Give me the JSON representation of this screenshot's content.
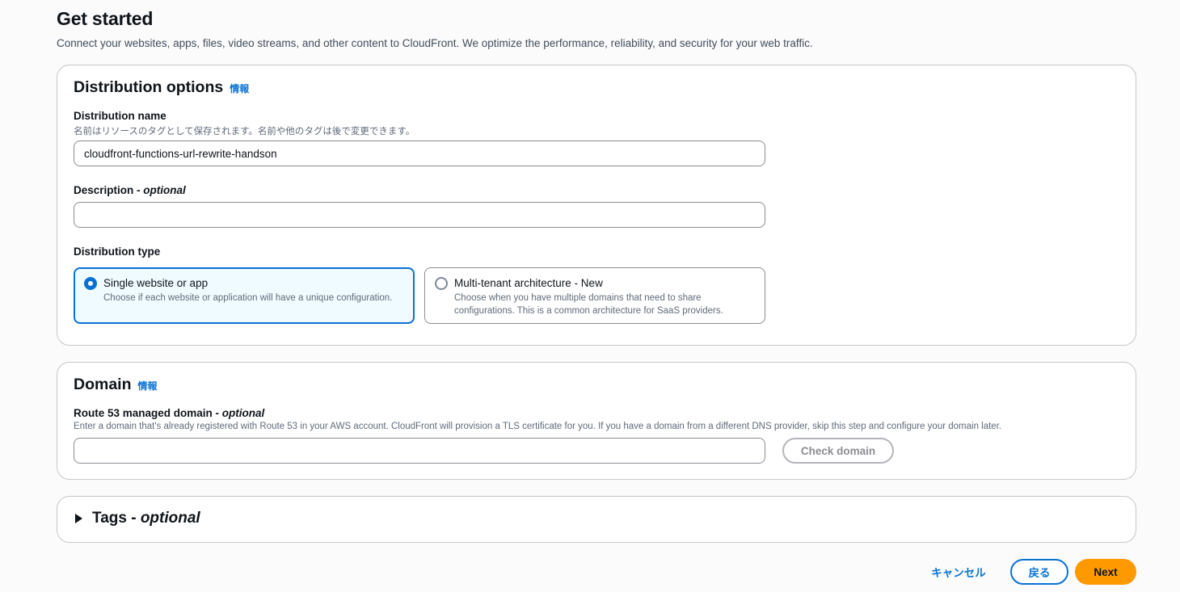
{
  "header": {
    "title": "Get started",
    "subtitle": "Connect your websites, apps, files, video streams, and other content to CloudFront. We optimize the performance, reliability, and security for your web traffic."
  },
  "distribution_options": {
    "title": "Distribution options",
    "info_label": "情報",
    "name_field": {
      "label": "Distribution name",
      "description": "名前はリソースのタグとして保存されます。名前や他のタグは後で変更できます。",
      "value": "cloudfront-functions-url-rewrite-handson"
    },
    "description_field": {
      "label": "Description - ",
      "optional": "optional",
      "value": ""
    },
    "type": {
      "label": "Distribution type",
      "options": [
        {
          "title": "Single website or app",
          "description": "Choose if each website or application will have a unique configuration.",
          "selected": true
        },
        {
          "title": "Multi-tenant architecture - New",
          "description": "Choose when you have multiple domains that need to share configurations. This is a common architecture for SaaS providers.",
          "selected": false
        }
      ]
    }
  },
  "domain": {
    "title": "Domain",
    "info_label": "情報",
    "route53_field": {
      "label": "Route 53 managed domain - ",
      "optional": "optional",
      "description": "Enter a domain that's already registered with Route 53 in your AWS account. CloudFront will provision a TLS certificate for you. If you have a domain from a different DNS provider, skip this step and configure your domain later.",
      "value": ""
    },
    "check_button": "Check domain"
  },
  "tags": {
    "title": "Tags - ",
    "optional": "optional",
    "expanded": false
  },
  "footer": {
    "cancel": "キャンセル",
    "back": "戻る",
    "next": "Next"
  },
  "colors": {
    "link": "#0972d3",
    "primary_button": "#ff9900",
    "selected_tile_bg": "#f0fbff"
  }
}
